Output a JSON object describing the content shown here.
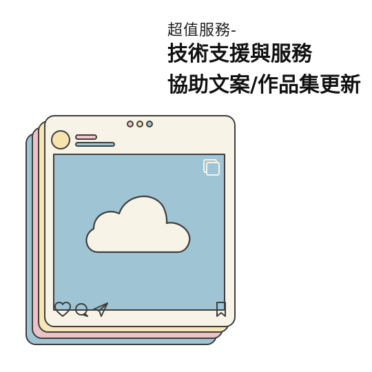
{
  "header": {
    "subtitle": "超值服務-",
    "title_line1": "技術支援與服務",
    "title_line2": "協助文案/作品集更新"
  },
  "illustration": {
    "type": "social-post-card-stack",
    "card_colors": [
      "#9fc4d3",
      "#ecc3c7",
      "#f6e7b7",
      "#f8f3e7"
    ],
    "image_area_color": "#9fc4d3",
    "cloud_color": "#f8f3e7",
    "outline_color": "#3d3d3d",
    "window_dots": [
      "#f3c3c8",
      "#f6e3ad",
      "#9fc4d3"
    ],
    "icons": [
      "avatar-icon",
      "heart-icon",
      "comment-icon",
      "send-icon",
      "bookmark-icon",
      "multi-image-icon",
      "cloud-icon"
    ]
  }
}
